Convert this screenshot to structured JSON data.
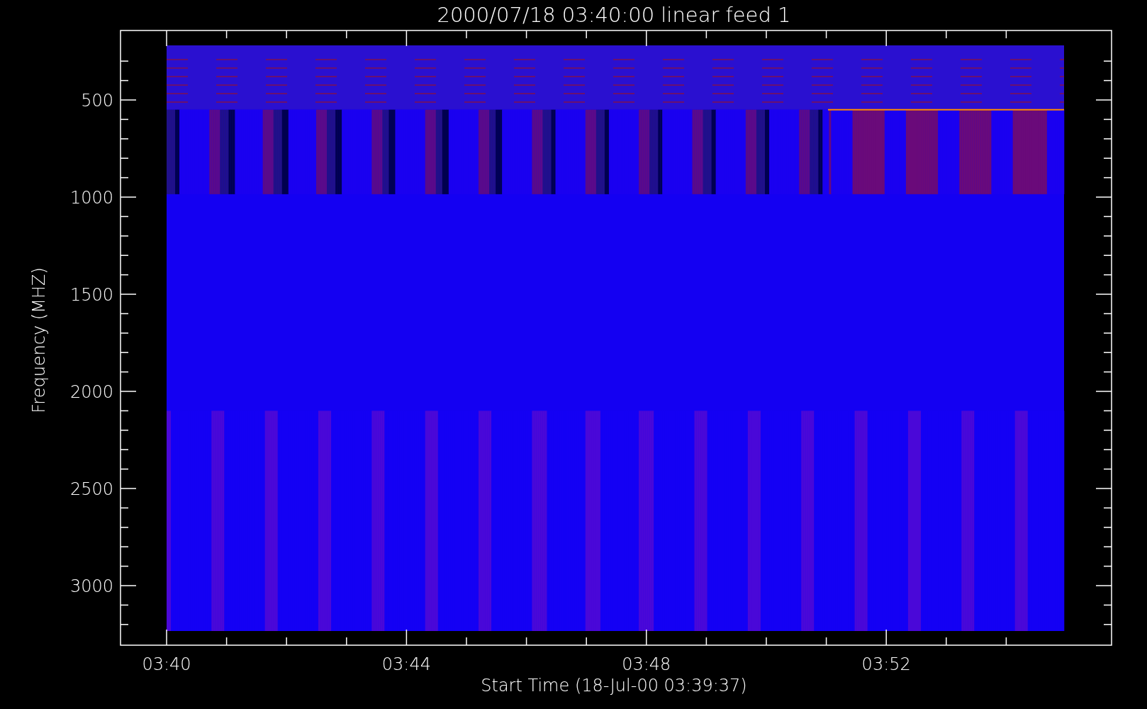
{
  "title": "2000/07/18 03:40:00 linear feed 1",
  "y_axis": {
    "label": "Frequency (MHZ)",
    "ticks": [
      "500",
      "1000",
      "1500",
      "2000",
      "2500",
      "3000"
    ]
  },
  "x_axis": {
    "label": "Start Time (18-Jul-00 03:39:37)",
    "ticks": [
      "03:40",
      "03:44",
      "03:48",
      "03:52"
    ]
  }
}
